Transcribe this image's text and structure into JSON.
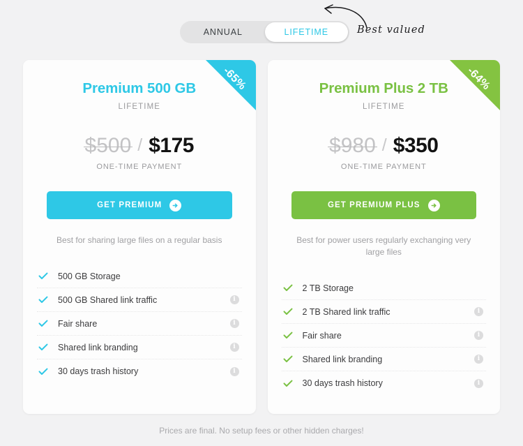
{
  "toggle": {
    "options": [
      {
        "label": "ANNUAL",
        "active": false
      },
      {
        "label": "LIFETIME",
        "active": true
      }
    ],
    "annotation": "Best valued",
    "arrow_icon": "curved-arrow-icon"
  },
  "colors": {
    "page_background": "#f2f2f3",
    "card_background": "#fdfdfd",
    "cyan": "#2ec8e6",
    "green": "#7ac143",
    "ribbon_green": "#84c341",
    "price_new": "#121212",
    "price_old": "#c3c3c5",
    "muted_text": "#9a9a9d"
  },
  "cards": [
    {
      "accent": "cyan",
      "ribbon": "-65%",
      "title": "Premium 500 GB",
      "period": "LIFETIME",
      "price_old": "$500",
      "price_separator": "/",
      "price_new": "$175",
      "price_note": "ONE-TIME PAYMENT",
      "cta_label": "GET PREMIUM",
      "cta_icon": "arrow-right-circle-icon",
      "description": "Best for sharing large files on a regular basis",
      "features": [
        {
          "label": "500 GB Storage",
          "info": false
        },
        {
          "label": "500 GB Shared link traffic",
          "info": true
        },
        {
          "label": "Fair share",
          "info": true
        },
        {
          "label": "Shared link branding",
          "info": true
        },
        {
          "label": "30 days trash history",
          "info": true
        }
      ]
    },
    {
      "accent": "green",
      "ribbon": "-64%",
      "title": "Premium Plus 2 TB",
      "period": "LIFETIME",
      "price_old": "$980",
      "price_separator": "/",
      "price_new": "$350",
      "price_note": "ONE-TIME PAYMENT",
      "cta_label": "GET PREMIUM PLUS",
      "cta_icon": "arrow-right-circle-icon",
      "description": "Best for power users regularly exchanging very large files",
      "features": [
        {
          "label": "2 TB Storage",
          "info": false
        },
        {
          "label": "2 TB Shared link traffic",
          "info": true
        },
        {
          "label": "Fair share",
          "info": true
        },
        {
          "label": "Shared link branding",
          "info": true
        },
        {
          "label": "30 days trash history",
          "info": true
        }
      ]
    }
  ],
  "footer": {
    "note": "Prices are final. No setup fees or other hidden charges!"
  }
}
